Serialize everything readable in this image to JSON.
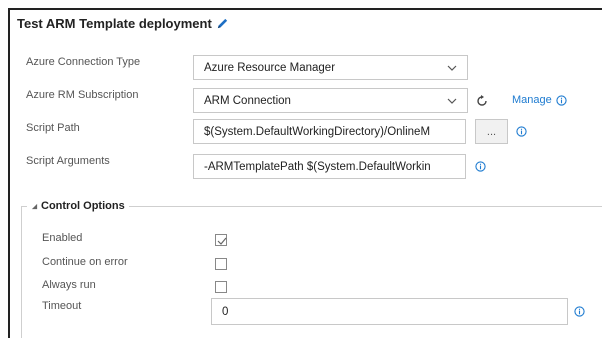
{
  "task": {
    "title": "Test ARM Template deployment"
  },
  "fields": {
    "connection_type": {
      "label": "Azure Connection Type",
      "value": "Azure Resource Manager"
    },
    "subscription": {
      "label": "Azure RM Subscription",
      "value": "ARM Connection",
      "manage_label": "Manage"
    },
    "script_path": {
      "label": "Script Path",
      "value": "$(System.DefaultWorkingDirectory)/OnlineM",
      "browse_label": "..."
    },
    "script_arguments": {
      "label": "Script Arguments",
      "value": "-ARMTemplatePath $(System.DefaultWorkin"
    }
  },
  "control_options": {
    "legend": "Control Options",
    "enabled": {
      "label": "Enabled",
      "checked": true
    },
    "continue_on_error": {
      "label": "Continue on error",
      "checked": false
    },
    "always_run": {
      "label": "Always run",
      "checked": false
    },
    "timeout": {
      "label": "Timeout",
      "value": "0"
    }
  },
  "colors": {
    "accent": "#1e7bd0",
    "label": "#555555"
  },
  "icons": {
    "title_edit": "pencil-icon",
    "refresh": "refresh-icon",
    "info": "info-icon",
    "dropdown": "chevron-down-icon",
    "collapse": "triangle-collapse-icon",
    "check": "checkmark-icon"
  }
}
